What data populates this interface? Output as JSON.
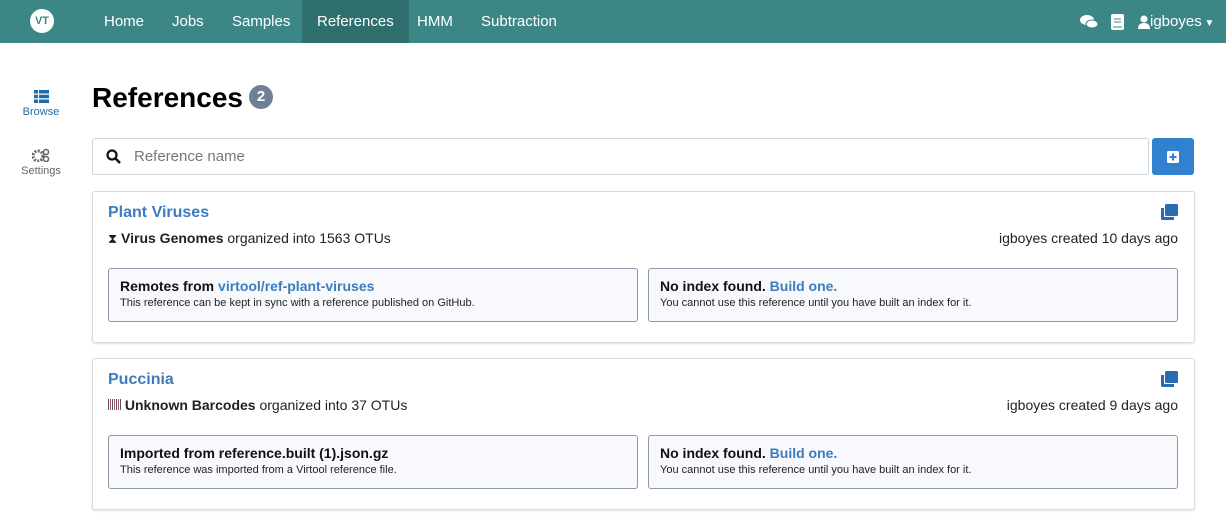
{
  "nav": {
    "logo": "VT",
    "items": [
      "Home",
      "Jobs",
      "Samples",
      "References",
      "HMM",
      "Subtraction"
    ],
    "active": "References",
    "user": "igboyes"
  },
  "sidebar": {
    "browse": "Browse",
    "settings": "Settings"
  },
  "page": {
    "title": "References",
    "count": "2",
    "search_placeholder": "Reference name"
  },
  "references": [
    {
      "name": "Plant Viruses",
      "data_type": "Virus Genomes",
      "organized": "organized into 1563 OTUs",
      "created": "igboyes created 10 days ago",
      "left_title": "Remotes from ",
      "left_link": "virtool/ref-plant-viruses",
      "left_sub": "This reference can be kept in sync with a reference published on GitHub.",
      "right_title": "No index found. ",
      "right_link": "Build one.",
      "right_sub": "You cannot use this reference until you have built an index for it."
    },
    {
      "name": "Puccinia",
      "data_type": "Unknown Barcodes",
      "organized": "organized into 37 OTUs",
      "created": "igboyes created 9 days ago",
      "left_title": "Imported from reference.built (1).json.gz",
      "left_link": "",
      "left_sub": "This reference was imported from a Virtool reference file.",
      "right_title": "No index found. ",
      "right_link": "Build one.",
      "right_sub": "You cannot use this reference until you have built an index for it."
    }
  ]
}
